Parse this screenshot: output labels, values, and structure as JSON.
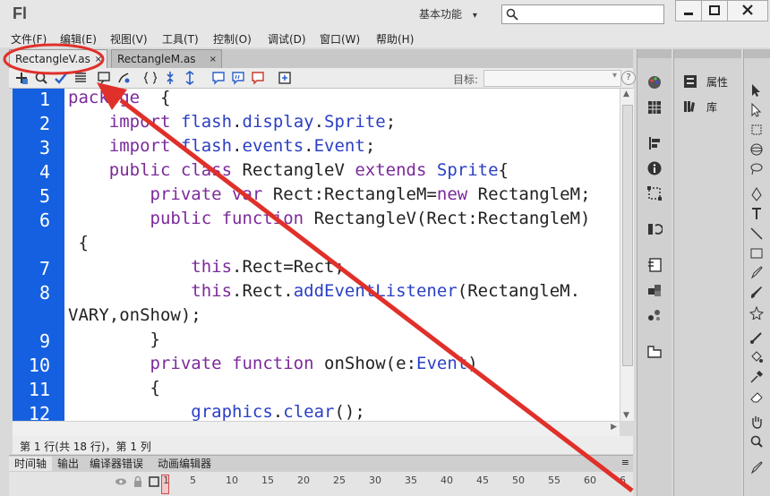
{
  "window": {
    "logo": "Fl",
    "workspace": "基本功能",
    "workspace_arrow": "▾",
    "search_placeholder": ""
  },
  "menubar": {
    "items": [
      "文件(F)",
      "编辑(E)",
      "视图(V)",
      "工具(T)",
      "控制(O)",
      "调试(D)",
      "窗口(W)",
      "帮助(H)"
    ]
  },
  "tabs": [
    {
      "label": "RectangleV.as",
      "close": "×",
      "active": true
    },
    {
      "label": "RectangleM.as",
      "close": "×",
      "active": false
    }
  ],
  "toolbar": {
    "target_label": "目标:",
    "help": "?"
  },
  "code": {
    "line_numbers": [
      "1",
      "2",
      "3",
      "4",
      "5",
      "6",
      "7",
      "8",
      "9",
      "10",
      "11",
      "12"
    ],
    "lines": [
      "package  {",
      "    import flash.display.Sprite;",
      "    import flash.events.Event;",
      "    public class RectangleV extends Sprite{",
      "        private var Rect:RectangleM=new RectangleM;",
      "        public function RectangleV(Rect:RectangleM)",
      " {",
      "            this.Rect=Rect;",
      "            this.Rect.addEventListener(RectangleM.",
      "VARY,onShow);",
      "        }",
      "        private function onShow(e:Event)",
      "        {",
      "            graphics.clear();"
    ]
  },
  "status": {
    "text": "第 1 行(共 18 行)，第 1 列"
  },
  "bottom_tabs": [
    "时间轴",
    "输出",
    "编译器错误",
    "动画编辑器"
  ],
  "timeline": {
    "ticks": [
      "1",
      "5",
      "10",
      "15",
      "20",
      "25",
      "30",
      "35",
      "40",
      "45",
      "50",
      "55",
      "60",
      "6"
    ]
  },
  "panels": {
    "properties": "属性",
    "library": "库"
  },
  "colors": {
    "gutter": "#1560e0",
    "keyword": "#7b2a9a",
    "type": "#2a3fc4",
    "annotation": "#e0302a"
  }
}
